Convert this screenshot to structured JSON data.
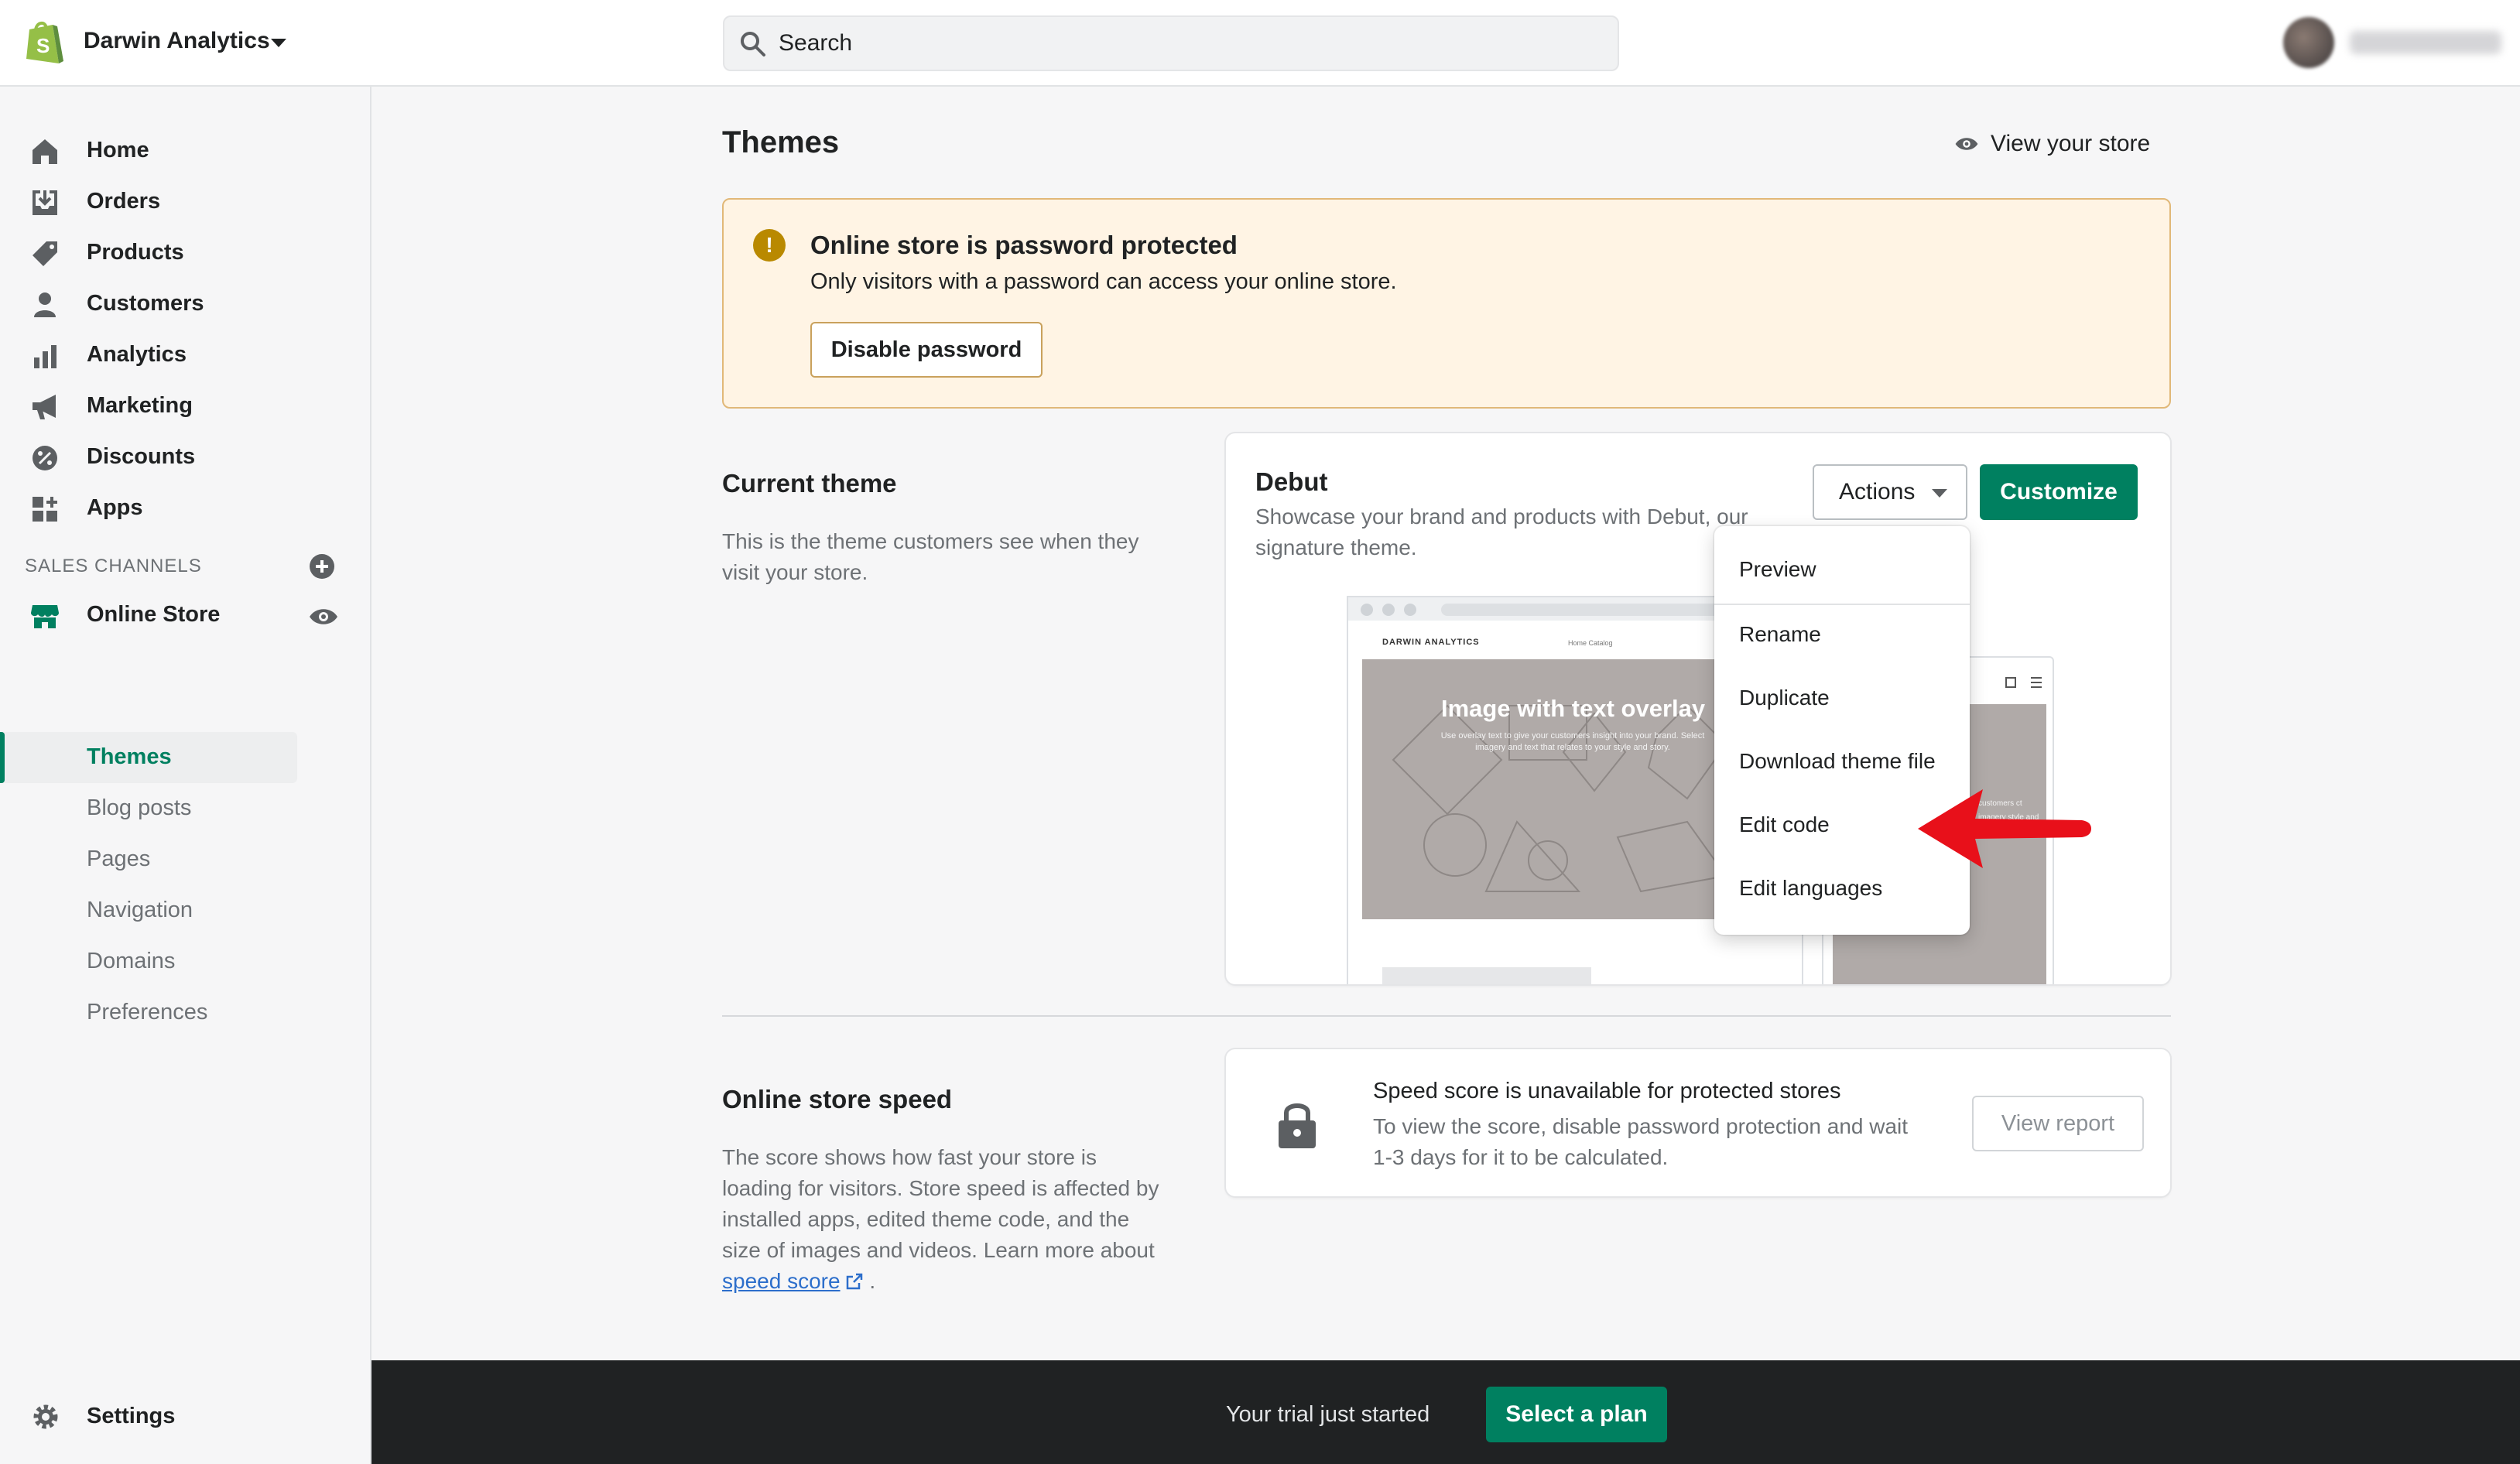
{
  "header": {
    "store_name": "Darwin Analytics",
    "search_placeholder": "Search"
  },
  "sidebar": {
    "items": [
      {
        "label": "Home",
        "icon": "home-icon"
      },
      {
        "label": "Orders",
        "icon": "orders-icon"
      },
      {
        "label": "Products",
        "icon": "tag-icon"
      },
      {
        "label": "Customers",
        "icon": "person-icon"
      },
      {
        "label": "Analytics",
        "icon": "bar-chart-icon"
      },
      {
        "label": "Marketing",
        "icon": "megaphone-icon"
      },
      {
        "label": "Discounts",
        "icon": "discount-icon"
      },
      {
        "label": "Apps",
        "icon": "apps-icon"
      }
    ],
    "sales_channels_title": "SALES CHANNELS",
    "online_store": "Online Store",
    "sub_items": [
      "Themes",
      "Blog posts",
      "Pages",
      "Navigation",
      "Domains",
      "Preferences"
    ],
    "active_sub_item": "Themes",
    "settings": "Settings"
  },
  "page": {
    "title": "Themes",
    "view_store": "View your store"
  },
  "banner": {
    "title": "Online store is password protected",
    "text": "Only visitors with a password can access your online store.",
    "button": "Disable password"
  },
  "current_theme": {
    "section_title": "Current theme",
    "section_desc": "This is the theme customers see when they visit your store.",
    "theme_name": "Debut",
    "theme_desc": "Showcase your brand and products with Debut, our signature theme.",
    "actions_label": "Actions",
    "customize_label": "Customize",
    "preview": {
      "brand": "DARWIN ANALYTICS",
      "links": "Home   Catalog",
      "hero_title": "Image with text overlay",
      "hero_sub": "Use overlay text to give your customers insight into your brand. Select imagery and text that relates to your style and story.",
      "mobile_text": "customers ct imagery style and"
    }
  },
  "actions_menu": {
    "items": [
      "Preview",
      "Rename",
      "Duplicate",
      "Download theme file",
      "Edit code",
      "Edit languages"
    ]
  },
  "speed": {
    "section_title": "Online store speed",
    "section_desc": "The score shows how fast your store is loading for visitors. Store speed is affected by installed apps, edited theme code, and the size of images and videos. Learn more about",
    "link_text": "speed score",
    "after_link": ".",
    "card_title": "Speed score is unavailable for protected stores",
    "card_text": "To view the score, disable password protection and wait 1-3 days for it to be calculated.",
    "button": "View report"
  },
  "trial": {
    "text": "Your trial just started",
    "button": "Select a plan"
  },
  "colors": {
    "primary_green": "#008060",
    "warning_bg": "#fff4e4",
    "warning_icon": "#b98900",
    "annotation_arrow": "#e8101a"
  }
}
